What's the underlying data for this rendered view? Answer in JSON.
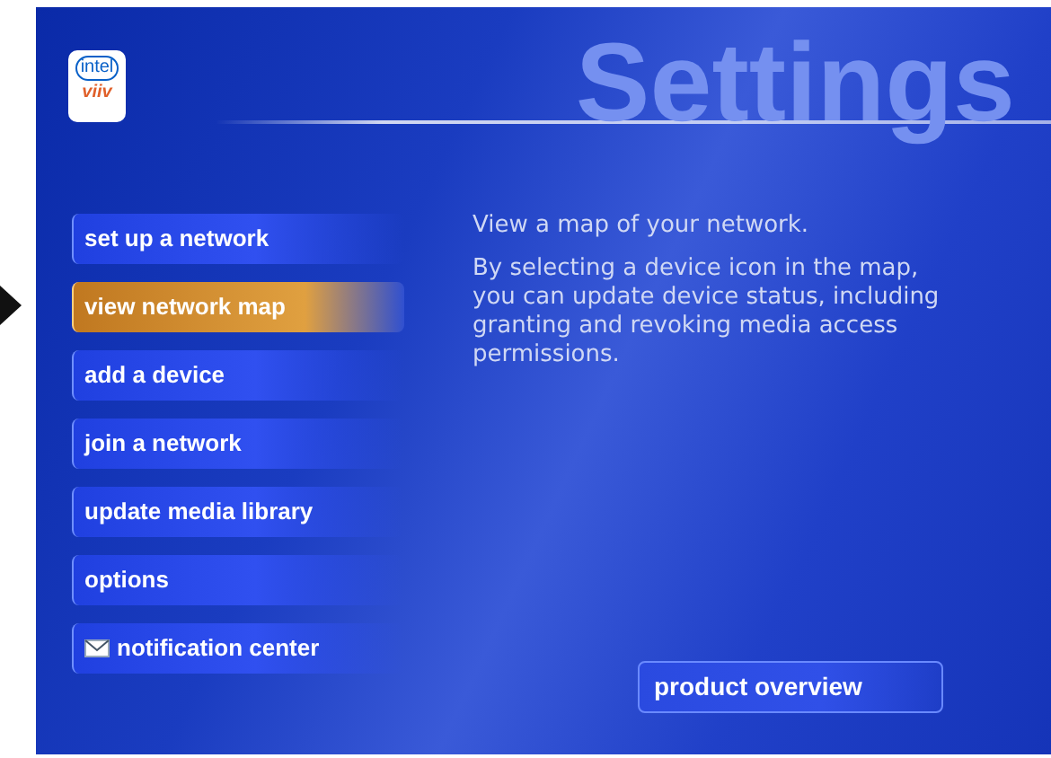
{
  "logo": {
    "brand": "intel",
    "sub": "viiv"
  },
  "header": {
    "title": "Settings"
  },
  "menu": [
    {
      "label": "set up a network",
      "selected": false,
      "kind": "plain"
    },
    {
      "label": "view network map",
      "selected": true,
      "kind": "plain"
    },
    {
      "label": "add a device",
      "selected": false,
      "kind": "plain"
    },
    {
      "label": "join a network",
      "selected": false,
      "kind": "plain"
    },
    {
      "label": "update media library",
      "selected": false,
      "kind": "plain"
    },
    {
      "label": "options",
      "selected": false,
      "kind": "plain"
    },
    {
      "label": "notification center",
      "selected": false,
      "kind": "mail"
    }
  ],
  "description": {
    "heading": "View a map of your network.",
    "body": "By selecting a device icon in the map, you can update device status, including granting and revoking media access permissions."
  },
  "footer_button": {
    "label": "product overview"
  }
}
